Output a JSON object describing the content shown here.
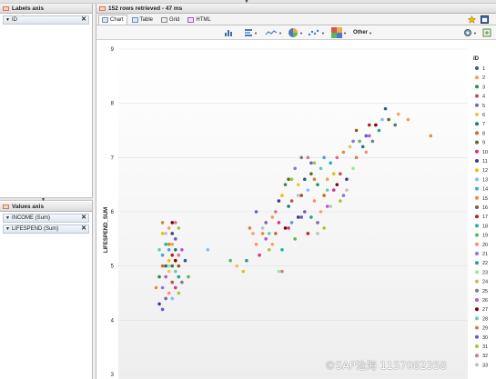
{
  "labels_axis": {
    "title": "Labels axis",
    "items": [
      {
        "label": "ID"
      }
    ]
  },
  "values_axis": {
    "title": "Values axis",
    "items": [
      {
        "label": "INCOME (Sum)"
      },
      {
        "label": "LIFESPEND (Sum)"
      }
    ]
  },
  "status": {
    "text": "152 rows retrieved - 47 ms"
  },
  "tabs": [
    {
      "label": "Chart"
    },
    {
      "label": "Table"
    },
    {
      "label": "Grid"
    },
    {
      "label": "HTML"
    }
  ],
  "toolbar": {
    "other_label": "Other"
  },
  "watermark": "©SAP沧海 1157082358",
  "colors": {
    "accent": "#3a6ea5",
    "panel_header": "#dcdcdc"
  },
  "chart_data": {
    "type": "scatter",
    "title": "",
    "xlabel": "",
    "ylabel": "LIFESPEND_SUM",
    "ylim": [
      3,
      9
    ],
    "xlim": [
      0,
      100
    ],
    "y_ticks": [
      "3",
      "4",
      "5",
      "6",
      "7",
      "8",
      "9"
    ],
    "grid": true,
    "legend_title": "ID",
    "legend_position": "right",
    "legend_entries": [
      "1",
      "2",
      "3",
      "4",
      "5",
      "6",
      "7",
      "8",
      "9",
      "10",
      "11",
      "12",
      "13",
      "14",
      "15",
      "16",
      "17",
      "18",
      "19",
      "20",
      "21",
      "22",
      "23",
      "24",
      "25",
      "26",
      "27",
      "28",
      "29",
      "30",
      "31",
      "32",
      "33"
    ],
    "palette": [
      "#2f5d8c",
      "#f0a050",
      "#2e8b57",
      "#c0504d",
      "#8064a2",
      "#f2c14e",
      "#1f7a7a",
      "#d2691e",
      "#556b2f",
      "#d63384",
      "#3c3c8c",
      "#e6c200",
      "#7fbfff",
      "#4aa3df",
      "#e88b3a",
      "#8b5a2b",
      "#b22222",
      "#20b2aa",
      "#5cb85c",
      "#ff8c69",
      "#9370db",
      "#2a9d8f",
      "#90ee90",
      "#f4a460",
      "#708090",
      "#ba55d3",
      "#800000",
      "#66cdaa",
      "#cd853f",
      "#6a5acd",
      "#9acd32",
      "#db7093",
      "#c0c0c0"
    ],
    "points": [
      {
        "x": 10,
        "y": 4.6,
        "s": 15
      },
      {
        "x": 11,
        "y": 4.3,
        "s": 11
      },
      {
        "x": 11,
        "y": 4.8,
        "s": 3
      },
      {
        "x": 12,
        "y": 5.0,
        "s": 8
      },
      {
        "x": 12,
        "y": 5.2,
        "s": 14
      },
      {
        "x": 12,
        "y": 5.6,
        "s": 12
      },
      {
        "x": 12,
        "y": 5.8,
        "s": 29
      },
      {
        "x": 12,
        "y": 4.6,
        "s": 21
      },
      {
        "x": 13,
        "y": 4.4,
        "s": 5
      },
      {
        "x": 13,
        "y": 5.0,
        "s": 1
      },
      {
        "x": 13,
        "y": 5.4,
        "s": 18
      },
      {
        "x": 13,
        "y": 4.8,
        "s": 26
      },
      {
        "x": 14,
        "y": 5.0,
        "s": 23
      },
      {
        "x": 14,
        "y": 4.9,
        "s": 6
      },
      {
        "x": 14,
        "y": 5.1,
        "s": 12
      },
      {
        "x": 14,
        "y": 5.3,
        "s": 14
      },
      {
        "x": 14,
        "y": 5.7,
        "s": 24
      },
      {
        "x": 14,
        "y": 4.5,
        "s": 20
      },
      {
        "x": 15,
        "y": 4.7,
        "s": 4
      },
      {
        "x": 15,
        "y": 5.0,
        "s": 9
      },
      {
        "x": 15,
        "y": 5.2,
        "s": 17
      },
      {
        "x": 15,
        "y": 5.4,
        "s": 2
      },
      {
        "x": 15,
        "y": 5.6,
        "s": 11
      },
      {
        "x": 15,
        "y": 4.4,
        "s": 13
      },
      {
        "x": 16,
        "y": 4.9,
        "s": 28
      },
      {
        "x": 16,
        "y": 5.1,
        "s": 27
      },
      {
        "x": 16,
        "y": 5.3,
        "s": 7
      },
      {
        "x": 16,
        "y": 5.5,
        "s": 30
      },
      {
        "x": 16,
        "y": 4.6,
        "s": 10
      },
      {
        "x": 17,
        "y": 5.0,
        "s": 16
      },
      {
        "x": 17,
        "y": 4.8,
        "s": 22
      },
      {
        "x": 17,
        "y": 5.7,
        "s": 31
      },
      {
        "x": 17,
        "y": 5.2,
        "s": 32
      },
      {
        "x": 18,
        "y": 4.7,
        "s": 25
      },
      {
        "x": 19,
        "y": 5.1,
        "s": 1
      },
      {
        "x": 20,
        "y": 4.8,
        "s": 19
      },
      {
        "x": 26,
        "y": 5.3,
        "s": 13
      },
      {
        "x": 33,
        "y": 5.1,
        "s": 19
      },
      {
        "x": 35,
        "y": 5.0,
        "s": 6
      },
      {
        "x": 37,
        "y": 4.9,
        "s": 12
      },
      {
        "x": 38,
        "y": 5.1,
        "s": 22
      },
      {
        "x": 39,
        "y": 5.7,
        "s": 29
      },
      {
        "x": 40,
        "y": 5.6,
        "s": 24
      },
      {
        "x": 41,
        "y": 5.4,
        "s": 20
      },
      {
        "x": 41,
        "y": 6.0,
        "s": 30
      },
      {
        "x": 42,
        "y": 5.2,
        "s": 10
      },
      {
        "x": 43,
        "y": 5.6,
        "s": 15
      },
      {
        "x": 44,
        "y": 5.5,
        "s": 26
      },
      {
        "x": 44,
        "y": 5.8,
        "s": 5
      },
      {
        "x": 45,
        "y": 5.6,
        "s": 28
      },
      {
        "x": 46,
        "y": 5.9,
        "s": 2
      },
      {
        "x": 46,
        "y": 5.4,
        "s": 24
      },
      {
        "x": 47,
        "y": 5.6,
        "s": 8
      },
      {
        "x": 48,
        "y": 5.8,
        "s": 10
      },
      {
        "x": 48,
        "y": 4.9,
        "s": 23
      },
      {
        "x": 49,
        "y": 5.3,
        "s": 18
      },
      {
        "x": 49,
        "y": 6.3,
        "s": 12
      },
      {
        "x": 50,
        "y": 5.7,
        "s": 27
      },
      {
        "x": 50,
        "y": 6.5,
        "s": 3
      },
      {
        "x": 51,
        "y": 6.1,
        "s": 7
      },
      {
        "x": 51,
        "y": 6.6,
        "s": 9
      },
      {
        "x": 52,
        "y": 5.8,
        "s": 14
      },
      {
        "x": 52,
        "y": 6.2,
        "s": 4
      },
      {
        "x": 53,
        "y": 6.8,
        "s": 21
      },
      {
        "x": 53,
        "y": 5.5,
        "s": 19
      },
      {
        "x": 54,
        "y": 6.5,
        "s": 6
      },
      {
        "x": 54,
        "y": 5.9,
        "s": 11
      },
      {
        "x": 55,
        "y": 6.3,
        "s": 16
      },
      {
        "x": 55,
        "y": 7.0,
        "s": 25
      },
      {
        "x": 56,
        "y": 6.0,
        "s": 30
      },
      {
        "x": 56,
        "y": 6.6,
        "s": 1
      },
      {
        "x": 57,
        "y": 5.6,
        "s": 17
      },
      {
        "x": 57,
        "y": 6.4,
        "s": 13
      },
      {
        "x": 58,
        "y": 6.7,
        "s": 9
      },
      {
        "x": 58,
        "y": 5.9,
        "s": 22
      },
      {
        "x": 59,
        "y": 6.2,
        "s": 20
      },
      {
        "x": 59,
        "y": 6.9,
        "s": 31
      },
      {
        "x": 60,
        "y": 6.5,
        "s": 3
      },
      {
        "x": 60,
        "y": 5.8,
        "s": 5
      },
      {
        "x": 61,
        "y": 6.0,
        "s": 24
      },
      {
        "x": 61,
        "y": 6.8,
        "s": 28
      },
      {
        "x": 62,
        "y": 6.3,
        "s": 8
      },
      {
        "x": 62,
        "y": 7.0,
        "s": 14
      },
      {
        "x": 63,
        "y": 6.6,
        "s": 2
      },
      {
        "x": 63,
        "y": 6.1,
        "s": 26
      },
      {
        "x": 64,
        "y": 6.9,
        "s": 18
      },
      {
        "x": 65,
        "y": 6.4,
        "s": 10
      },
      {
        "x": 65,
        "y": 6.7,
        "s": 12
      },
      {
        "x": 66,
        "y": 7.0,
        "s": 32
      },
      {
        "x": 66,
        "y": 6.5,
        "s": 27
      },
      {
        "x": 67,
        "y": 6.7,
        "s": 4
      },
      {
        "x": 68,
        "y": 6.3,
        "s": 21
      },
      {
        "x": 68,
        "y": 7.1,
        "s": 15
      },
      {
        "x": 69,
        "y": 6.6,
        "s": 11
      },
      {
        "x": 70,
        "y": 7.2,
        "s": 6
      },
      {
        "x": 71,
        "y": 6.8,
        "s": 23
      },
      {
        "x": 72,
        "y": 7.0,
        "s": 29
      },
      {
        "x": 72,
        "y": 7.5,
        "s": 16
      },
      {
        "x": 73,
        "y": 7.3,
        "s": 19
      },
      {
        "x": 74,
        "y": 7.2,
        "s": 7
      },
      {
        "x": 75,
        "y": 7.4,
        "s": 30
      },
      {
        "x": 76,
        "y": 7.6,
        "s": 17
      },
      {
        "x": 77,
        "y": 7.3,
        "s": 25
      },
      {
        "x": 79,
        "y": 7.5,
        "s": 22
      },
      {
        "x": 80,
        "y": 7.7,
        "s": 13
      },
      {
        "x": 81,
        "y": 7.9,
        "s": 1
      },
      {
        "x": 82,
        "y": 7.7,
        "s": 9
      },
      {
        "x": 84,
        "y": 7.6,
        "s": 3
      },
      {
        "x": 85,
        "y": 7.8,
        "s": 24
      },
      {
        "x": 88,
        "y": 7.7,
        "s": 2
      },
      {
        "x": 95,
        "y": 7.4,
        "s": 15
      },
      {
        "x": 54,
        "y": 6.3,
        "s": 33
      },
      {
        "x": 45,
        "y": 5.3,
        "s": 31
      },
      {
        "x": 49,
        "y": 4.9,
        "s": 32
      },
      {
        "x": 64,
        "y": 6.1,
        "s": 33
      },
      {
        "x": 57,
        "y": 7.0,
        "s": 32
      },
      {
        "x": 60,
        "y": 5.6,
        "s": 33
      },
      {
        "x": 67,
        "y": 6.2,
        "s": 31
      },
      {
        "x": 69,
        "y": 6.4,
        "s": 33
      },
      {
        "x": 52,
        "y": 6.6,
        "s": 31
      },
      {
        "x": 47,
        "y": 6.0,
        "s": 32
      },
      {
        "x": 43,
        "y": 5.7,
        "s": 33
      },
      {
        "x": 62,
        "y": 5.7,
        "s": 31
      },
      {
        "x": 58,
        "y": 6.9,
        "s": 30
      },
      {
        "x": 71,
        "y": 7.3,
        "s": 21
      },
      {
        "x": 75,
        "y": 7.1,
        "s": 20
      },
      {
        "x": 76,
        "y": 7.4,
        "s": 26
      },
      {
        "x": 78,
        "y": 7.6,
        "s": 27
      },
      {
        "x": 63,
        "y": 6.4,
        "s": 28
      },
      {
        "x": 59,
        "y": 6.6,
        "s": 29
      },
      {
        "x": 55,
        "y": 5.9,
        "s": 30
      },
      {
        "x": 51,
        "y": 5.7,
        "s": 10
      },
      {
        "x": 48,
        "y": 6.2,
        "s": 11
      },
      {
        "x": 13,
        "y": 5.6,
        "s": 33
      },
      {
        "x": 17,
        "y": 4.5,
        "s": 31
      },
      {
        "x": 12,
        "y": 4.2,
        "s": 30
      },
      {
        "x": 14,
        "y": 5.4,
        "s": 29
      },
      {
        "x": 16,
        "y": 5.8,
        "s": 32
      },
      {
        "x": 11,
        "y": 5.3,
        "s": 28
      },
      {
        "x": 15,
        "y": 5.8,
        "s": 27
      },
      {
        "x": 18,
        "y": 5.3,
        "s": 26
      }
    ]
  }
}
